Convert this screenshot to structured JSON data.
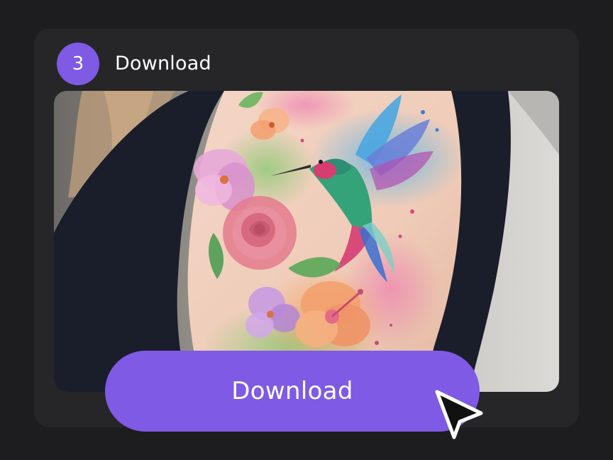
{
  "step": {
    "number": "3",
    "title": "Download"
  },
  "preview": {
    "icon": "tattoo-photo",
    "subject": "hummingbird and flowers watercolor shoulder tattoo"
  },
  "actions": {
    "download_label": "Download"
  },
  "colors": {
    "page_background": "#1d1d1f",
    "card_background": "#262628",
    "accent": "#7f5ae4",
    "text": "#ffffff"
  },
  "pointer": {
    "icon": "mouse-pointer-icon"
  }
}
